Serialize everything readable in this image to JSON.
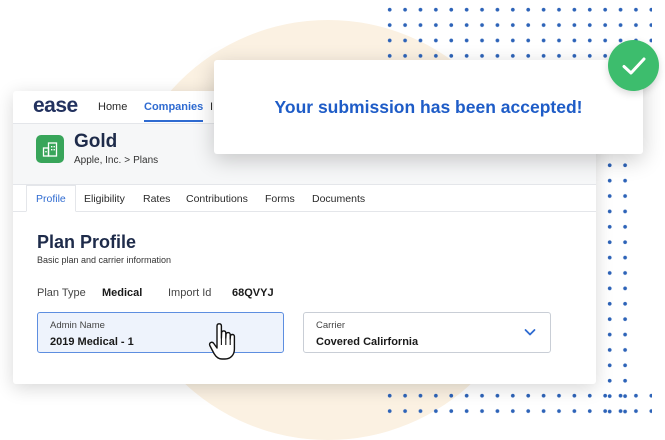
{
  "nav": {
    "logo": "ease",
    "home": "Home",
    "companies": "Companies",
    "more": "I"
  },
  "plan": {
    "name": "Gold",
    "company": "Apple, Inc.",
    "separator": ">",
    "crumb": "Plans"
  },
  "tabs": [
    "Profile",
    "Eligibility",
    "Rates",
    "Contributions",
    "Forms",
    "Documents"
  ],
  "section": {
    "title": "Plan Profile",
    "subtitle": "Basic plan and carrier information"
  },
  "meta": {
    "plan_type_label": "Plan Type",
    "plan_type_value": "Medical",
    "import_id_label": "Import Id",
    "import_id_value": "68QVYJ"
  },
  "fields": {
    "admin_name_label": "Admin Name",
    "admin_name_value": "2019 Medical - 1",
    "carrier_label": "Carrier",
    "carrier_value": "Covered Calirfornia"
  },
  "toast": {
    "message": "Your submission has been accepted!"
  },
  "colors": {
    "accent": "#2f6bd1",
    "success": "#3dbd6d",
    "plan_icon": "#38a55a",
    "dots": "#2d63b8"
  },
  "icons": {
    "plan": "building-icon",
    "carrier_dropdown": "chevron-down-icon",
    "cursor": "hand-pointer-icon",
    "success": "check-icon"
  }
}
